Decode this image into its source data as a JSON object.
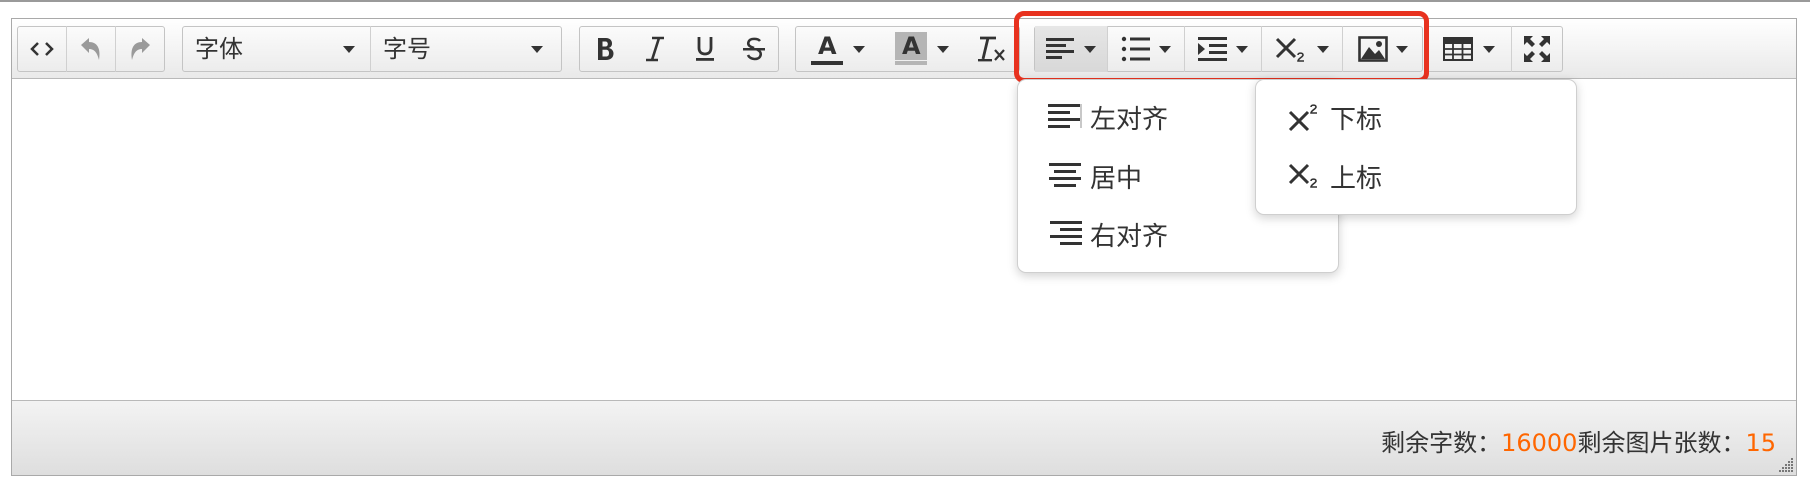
{
  "toolbar": {
    "font_family": {
      "label": "字体",
      "icon": "chevron-down-icon"
    },
    "font_size": {
      "label": "字号",
      "icon": "chevron-down-icon"
    },
    "buttons": [
      "source-code-icon",
      "undo-icon",
      "redo-icon",
      "bold-icon",
      "italic-icon",
      "underline-icon",
      "strikethrough-icon",
      "font-color-icon",
      "background-color-icon",
      "clear-format-icon",
      "align-icon",
      "list-icon",
      "indent-icon",
      "subscript-icon",
      "image-icon",
      "table-icon",
      "fullscreen-icon"
    ],
    "font_color_letter": "A",
    "bg_color_letter": "A",
    "font_color_underline": "#333333",
    "bg_color_fill": "#b5b5b5"
  },
  "highlight": {
    "color": "#e8321f"
  },
  "align_menu": {
    "items": [
      {
        "label": "左对齐",
        "icon": "align-left-icon"
      },
      {
        "label": "居中",
        "icon": "align-center-icon"
      },
      {
        "label": "右对齐",
        "icon": "align-right-icon"
      }
    ]
  },
  "script_menu": {
    "items": [
      {
        "label": "下标",
        "icon": "superscript-icon"
      },
      {
        "label": "上标",
        "icon": "subscript-icon"
      }
    ]
  },
  "status": {
    "chars_label": "剩余字数：",
    "chars_value": "16000",
    "images_label": "剩余图片张数：",
    "images_value": "15",
    "accent_color": "#ff6600"
  }
}
